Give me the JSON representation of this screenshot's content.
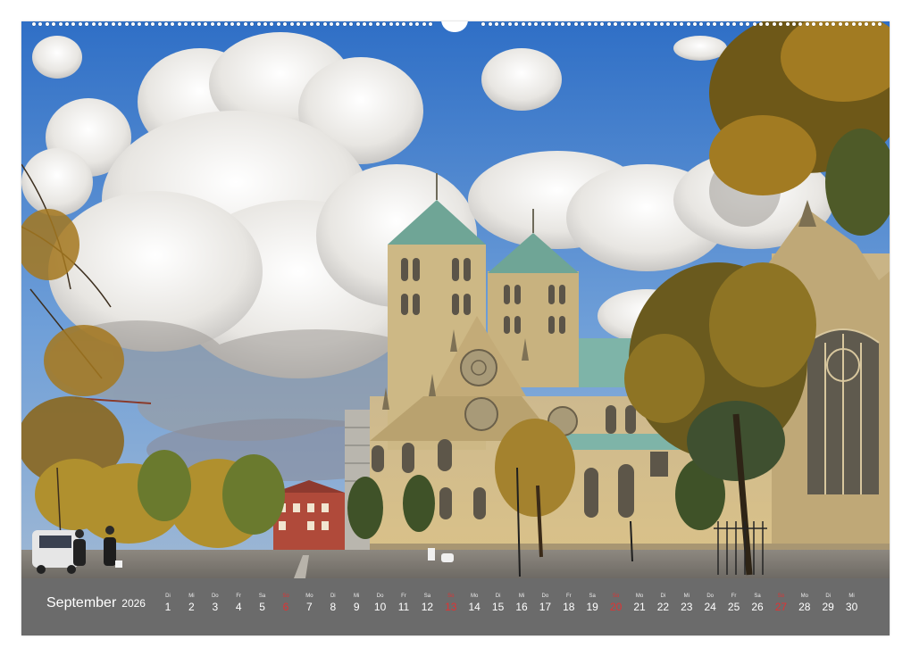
{
  "calendar": {
    "month": "September",
    "year": "2026",
    "days": [
      {
        "abbr": "Di",
        "num": "1",
        "sunday": false
      },
      {
        "abbr": "Mi",
        "num": "2",
        "sunday": false
      },
      {
        "abbr": "Do",
        "num": "3",
        "sunday": false
      },
      {
        "abbr": "Fr",
        "num": "4",
        "sunday": false
      },
      {
        "abbr": "Sa",
        "num": "5",
        "sunday": false
      },
      {
        "abbr": "So",
        "num": "6",
        "sunday": true
      },
      {
        "abbr": "Mo",
        "num": "7",
        "sunday": false
      },
      {
        "abbr": "Di",
        "num": "8",
        "sunday": false
      },
      {
        "abbr": "Mi",
        "num": "9",
        "sunday": false
      },
      {
        "abbr": "Do",
        "num": "10",
        "sunday": false
      },
      {
        "abbr": "Fr",
        "num": "11",
        "sunday": false
      },
      {
        "abbr": "Sa",
        "num": "12",
        "sunday": false
      },
      {
        "abbr": "So",
        "num": "13",
        "sunday": true
      },
      {
        "abbr": "Mo",
        "num": "14",
        "sunday": false
      },
      {
        "abbr": "Di",
        "num": "15",
        "sunday": false
      },
      {
        "abbr": "Mi",
        "num": "16",
        "sunday": false
      },
      {
        "abbr": "Do",
        "num": "17",
        "sunday": false
      },
      {
        "abbr": "Fr",
        "num": "18",
        "sunday": false
      },
      {
        "abbr": "Sa",
        "num": "19",
        "sunday": false
      },
      {
        "abbr": "So",
        "num": "20",
        "sunday": true
      },
      {
        "abbr": "Mo",
        "num": "21",
        "sunday": false
      },
      {
        "abbr": "Di",
        "num": "22",
        "sunday": false
      },
      {
        "abbr": "Mi",
        "num": "23",
        "sunday": false
      },
      {
        "abbr": "Do",
        "num": "24",
        "sunday": false
      },
      {
        "abbr": "Fr",
        "num": "25",
        "sunday": false
      },
      {
        "abbr": "Sa",
        "num": "26",
        "sunday": false
      },
      {
        "abbr": "So",
        "num": "27",
        "sunday": true
      },
      {
        "abbr": "Mo",
        "num": "28",
        "sunday": false
      },
      {
        "abbr": "Di",
        "num": "29",
        "sunday": false
      },
      {
        "abbr": "Mi",
        "num": "30",
        "sunday": false
      }
    ]
  },
  "colors": {
    "strip": "#6b6b6b",
    "sunday": "#e03333",
    "sky": "#3d7fd0",
    "stone": "#d6c08a",
    "roof": "#6fa596"
  },
  "photo": {
    "icon": "cathedral-photo"
  }
}
